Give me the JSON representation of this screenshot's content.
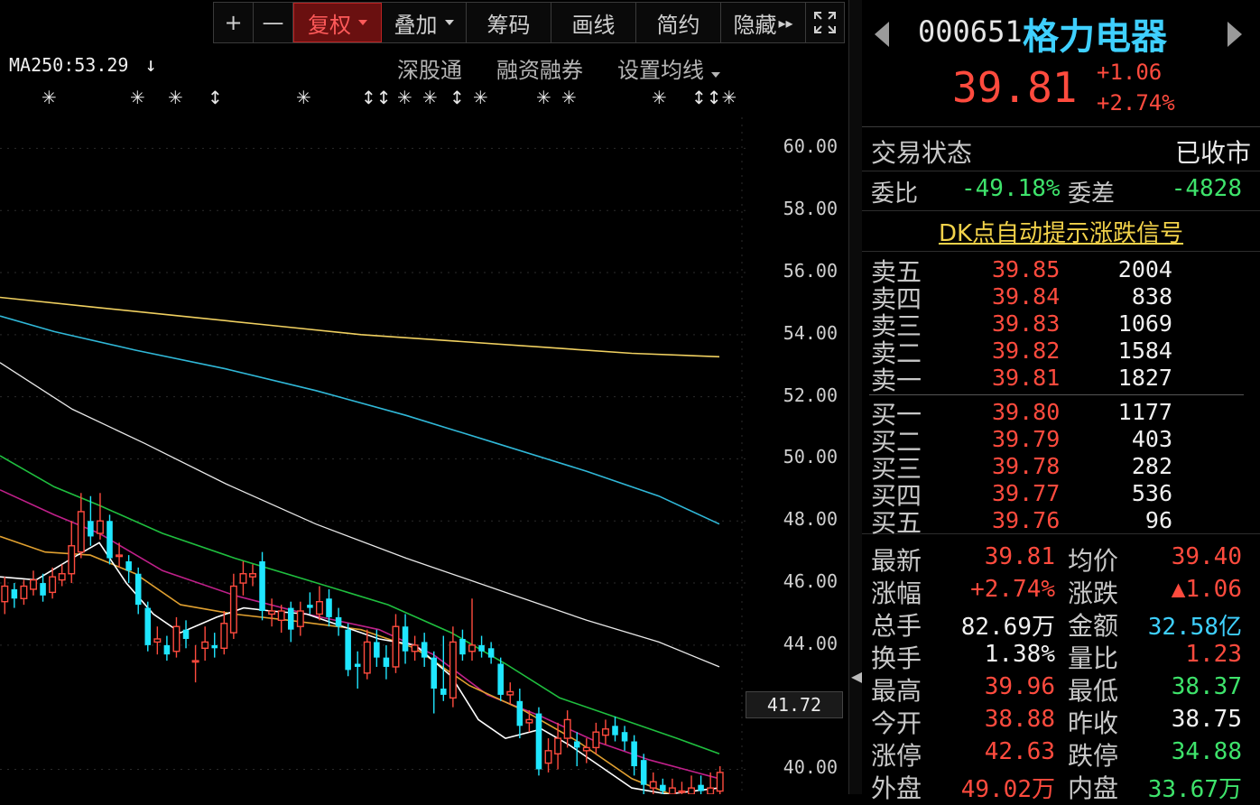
{
  "toolbar": {
    "plus": "+",
    "minus": "—",
    "fq": "复权",
    "overlay": "叠加",
    "chips": "筹码",
    "draw": "画线",
    "simple": "简约",
    "hide": "隐藏",
    "hide_more": "▸▸"
  },
  "ma_label": "MA250:53.29",
  "ma_arrow": "↓",
  "links": {
    "sz_connect": "深股通",
    "margin": "融资融券",
    "set_ma": "设置均线"
  },
  "markers": [
    "✳",
    "✳",
    "✳",
    "↕",
    "✳",
    "↕↕",
    "✳",
    "✳",
    "↕",
    "✳",
    "✳",
    "✳",
    "✳",
    "↕↕✳"
  ],
  "y_axis_labels": [
    "60.00",
    "58.00",
    "56.00",
    "54.00",
    "52.00",
    "50.00",
    "48.00",
    "46.00",
    "44.00",
    "40.00"
  ],
  "cursor_price": "41.72",
  "colors": {
    "up": "#ff4b3e",
    "down": "#1fe6ff",
    "ma5": "#ffffff",
    "ma10": "#e0a030",
    "ma20": "#c0208a",
    "ma30": "#1fbf3f",
    "ma60": "#e8e8e8",
    "ma120": "#30b8d8",
    "ma250": "#f0d060"
  },
  "chart_data": {
    "type": "candlestick",
    "ylim": [
      39.2,
      61.0
    ],
    "yticks": [
      60,
      58,
      56,
      54,
      52,
      50,
      48,
      46,
      44,
      40
    ],
    "candles": [
      {
        "o": 45.4,
        "c": 45.9,
        "h": 46.2,
        "l": 45.0
      },
      {
        "o": 45.8,
        "c": 45.5,
        "h": 46.0,
        "l": 45.2
      },
      {
        "o": 45.5,
        "c": 45.9,
        "h": 46.1,
        "l": 45.3
      },
      {
        "o": 45.8,
        "c": 46.1,
        "h": 46.4,
        "l": 45.6
      },
      {
        "o": 46.0,
        "c": 45.6,
        "h": 46.3,
        "l": 45.4
      },
      {
        "o": 45.7,
        "c": 46.2,
        "h": 46.5,
        "l": 45.5
      },
      {
        "o": 46.1,
        "c": 46.3,
        "h": 46.6,
        "l": 45.9
      },
      {
        "o": 46.3,
        "c": 47.2,
        "h": 48.0,
        "l": 46.0
      },
      {
        "o": 47.0,
        "c": 48.3,
        "h": 48.9,
        "l": 46.8
      },
      {
        "o": 48.0,
        "c": 47.5,
        "h": 48.8,
        "l": 47.2
      },
      {
        "o": 47.6,
        "c": 48.0,
        "h": 48.9,
        "l": 47.4
      },
      {
        "o": 48.0,
        "c": 46.8,
        "h": 48.2,
        "l": 46.6
      },
      {
        "o": 46.9,
        "c": 46.9,
        "h": 47.3,
        "l": 46.5
      },
      {
        "o": 46.7,
        "c": 46.4,
        "h": 46.9,
        "l": 46.0
      },
      {
        "o": 46.3,
        "c": 45.3,
        "h": 46.5,
        "l": 45.0
      },
      {
        "o": 45.2,
        "c": 44.0,
        "h": 45.4,
        "l": 43.8
      },
      {
        "o": 44.1,
        "c": 44.2,
        "h": 44.6,
        "l": 43.7
      },
      {
        "o": 44.0,
        "c": 43.7,
        "h": 44.3,
        "l": 43.5
      },
      {
        "o": 43.8,
        "c": 44.6,
        "h": 44.9,
        "l": 43.6
      },
      {
        "o": 44.5,
        "c": 44.2,
        "h": 44.8,
        "l": 43.9
      },
      {
        "o": 43.5,
        "c": 43.5,
        "h": 44.0,
        "l": 42.8
      },
      {
        "o": 43.9,
        "c": 44.1,
        "h": 44.6,
        "l": 43.5
      },
      {
        "o": 44.0,
        "c": 43.9,
        "h": 44.4,
        "l": 43.6
      },
      {
        "o": 43.9,
        "c": 44.7,
        "h": 45.1,
        "l": 43.7
      },
      {
        "o": 44.4,
        "c": 45.9,
        "h": 46.3,
        "l": 44.2
      },
      {
        "o": 46.0,
        "c": 46.3,
        "h": 46.7,
        "l": 45.6
      },
      {
        "o": 46.2,
        "c": 46.3,
        "h": 46.6,
        "l": 45.9
      },
      {
        "o": 46.7,
        "c": 45.1,
        "h": 47.0,
        "l": 44.8
      },
      {
        "o": 45.0,
        "c": 45.1,
        "h": 45.5,
        "l": 44.6
      },
      {
        "o": 44.8,
        "c": 45.1,
        "h": 45.3,
        "l": 44.4
      },
      {
        "o": 45.2,
        "c": 44.5,
        "h": 45.4,
        "l": 44.1
      },
      {
        "o": 44.6,
        "c": 45.1,
        "h": 45.4,
        "l": 44.3
      },
      {
        "o": 45.3,
        "c": 45.2,
        "h": 45.7,
        "l": 45.0
      },
      {
        "o": 45.0,
        "c": 45.4,
        "h": 45.9,
        "l": 44.8
      },
      {
        "o": 45.5,
        "c": 44.9,
        "h": 45.8,
        "l": 44.6
      },
      {
        "o": 44.9,
        "c": 44.6,
        "h": 45.2,
        "l": 44.3
      },
      {
        "o": 44.5,
        "c": 43.2,
        "h": 44.7,
        "l": 43.0
      },
      {
        "o": 43.4,
        "c": 43.3,
        "h": 43.8,
        "l": 42.6
      },
      {
        "o": 43.1,
        "c": 44.1,
        "h": 44.5,
        "l": 42.9
      },
      {
        "o": 44.1,
        "c": 43.6,
        "h": 44.5,
        "l": 43.3
      },
      {
        "o": 43.6,
        "c": 43.3,
        "h": 44.0,
        "l": 42.9
      },
      {
        "o": 43.3,
        "c": 44.6,
        "h": 45.0,
        "l": 43.1
      },
      {
        "o": 44.6,
        "c": 43.8,
        "h": 45.0,
        "l": 43.4
      },
      {
        "o": 43.8,
        "c": 44.0,
        "h": 44.3,
        "l": 43.5
      },
      {
        "o": 44.1,
        "c": 43.6,
        "h": 44.4,
        "l": 43.3
      },
      {
        "o": 43.6,
        "c": 42.6,
        "h": 43.8,
        "l": 41.8
      },
      {
        "o": 42.6,
        "c": 42.4,
        "h": 44.3,
        "l": 42.2
      },
      {
        "o": 42.3,
        "c": 44.1,
        "h": 44.6,
        "l": 42.0
      },
      {
        "o": 44.2,
        "c": 43.7,
        "h": 44.5,
        "l": 43.5
      },
      {
        "o": 43.8,
        "c": 44.0,
        "h": 45.5,
        "l": 43.5
      },
      {
        "o": 44.0,
        "c": 43.8,
        "h": 44.3,
        "l": 43.6
      },
      {
        "o": 43.9,
        "c": 43.6,
        "h": 44.1,
        "l": 43.4
      },
      {
        "o": 43.4,
        "c": 42.4,
        "h": 43.6,
        "l": 42.2
      },
      {
        "o": 42.4,
        "c": 42.5,
        "h": 42.8,
        "l": 42.1
      },
      {
        "o": 42.2,
        "c": 41.4,
        "h": 42.6,
        "l": 41.0
      },
      {
        "o": 41.5,
        "c": 41.6,
        "h": 41.9,
        "l": 41.2
      },
      {
        "o": 41.8,
        "c": 40.0,
        "h": 42.0,
        "l": 39.8
      },
      {
        "o": 40.2,
        "c": 40.6,
        "h": 41.0,
        "l": 39.9
      },
      {
        "o": 40.5,
        "c": 41.0,
        "h": 41.5,
        "l": 40.0
      },
      {
        "o": 41.0,
        "c": 41.6,
        "h": 41.9,
        "l": 40.7
      },
      {
        "o": 40.9,
        "c": 40.7,
        "h": 41.2,
        "l": 40.1
      },
      {
        "o": 40.6,
        "c": 40.7,
        "h": 41.0,
        "l": 40.2
      },
      {
        "o": 40.7,
        "c": 41.2,
        "h": 41.5,
        "l": 40.5
      },
      {
        "o": 41.1,
        "c": 41.3,
        "h": 41.6,
        "l": 40.8
      },
      {
        "o": 41.4,
        "c": 41.1,
        "h": 41.7,
        "l": 40.9
      },
      {
        "o": 41.2,
        "c": 40.9,
        "h": 41.4,
        "l": 40.6
      },
      {
        "o": 40.9,
        "c": 40.1,
        "h": 41.1,
        "l": 39.8
      },
      {
        "o": 40.3,
        "c": 39.5,
        "h": 40.5,
        "l": 39.2
      },
      {
        "o": 39.4,
        "c": 39.6,
        "h": 39.9,
        "l": 39.2
      },
      {
        "o": 39.5,
        "c": 39.3,
        "h": 39.7,
        "l": 39.1
      },
      {
        "o": 39.2,
        "c": 39.4,
        "h": 39.7,
        "l": 39.0
      },
      {
        "o": 39.3,
        "c": 39.3,
        "h": 39.6,
        "l": 39.1
      },
      {
        "o": 39.2,
        "c": 39.4,
        "h": 39.8,
        "l": 38.9
      },
      {
        "o": 39.5,
        "c": 39.3,
        "h": 39.8,
        "l": 39.0
      },
      {
        "o": 39.2,
        "c": 39.4,
        "h": 39.9,
        "l": 39.0
      },
      {
        "o": 39.3,
        "c": 39.9,
        "h": 40.1,
        "l": 38.9
      }
    ],
    "ma_lines": {
      "ma250": [
        [
          0,
          55.2
        ],
        [
          100,
          54.9
        ],
        [
          200,
          54.6
        ],
        [
          300,
          54.3
        ],
        [
          400,
          54.0
        ],
        [
          500,
          53.8
        ],
        [
          600,
          53.6
        ],
        [
          700,
          53.4
        ],
        [
          797,
          53.29
        ]
      ],
      "ma120": [
        [
          0,
          54.6
        ],
        [
          60,
          54.1
        ],
        [
          150,
          53.5
        ],
        [
          250,
          52.9
        ],
        [
          350,
          52.2
        ],
        [
          450,
          51.4
        ],
        [
          550,
          50.5
        ],
        [
          650,
          49.6
        ],
        [
          730,
          48.8
        ],
        [
          797,
          47.9
        ]
      ],
      "ma60": [
        [
          0,
          53.1
        ],
        [
          80,
          51.6
        ],
        [
          160,
          50.5
        ],
        [
          250,
          49.2
        ],
        [
          350,
          47.9
        ],
        [
          450,
          46.8
        ],
        [
          560,
          45.7
        ],
        [
          650,
          44.8
        ],
        [
          730,
          44.1
        ],
        [
          797,
          43.3
        ]
      ],
      "ma30": [
        [
          0,
          50.1
        ],
        [
          60,
          49.1
        ],
        [
          110,
          48.5
        ],
        [
          180,
          47.6
        ],
        [
          260,
          46.8
        ],
        [
          340,
          46.1
        ],
        [
          430,
          45.3
        ],
        [
          500,
          44.4
        ],
        [
          560,
          43.4
        ],
        [
          620,
          42.3
        ],
        [
          690,
          41.6
        ],
        [
          750,
          41.0
        ],
        [
          797,
          40.5
        ]
      ],
      "ma20": [
        [
          0,
          49.0
        ],
        [
          60,
          48.2
        ],
        [
          110,
          47.6
        ],
        [
          180,
          46.4
        ],
        [
          260,
          45.6
        ],
        [
          340,
          45.0
        ],
        [
          420,
          44.5
        ],
        [
          480,
          43.7
        ],
        [
          540,
          42.4
        ],
        [
          600,
          41.7
        ],
        [
          660,
          40.9
        ],
        [
          720,
          40.3
        ],
        [
          797,
          39.7
        ]
      ],
      "ma10": [
        [
          0,
          47.5
        ],
        [
          50,
          47.0
        ],
        [
          100,
          46.9
        ],
        [
          150,
          46.3
        ],
        [
          200,
          45.3
        ],
        [
          260,
          45.0
        ],
        [
          320,
          44.8
        ],
        [
          400,
          44.5
        ],
        [
          460,
          43.9
        ],
        [
          520,
          42.7
        ],
        [
          580,
          41.9
        ],
        [
          640,
          40.9
        ],
        [
          700,
          39.7
        ],
        [
          760,
          39.0
        ],
        [
          797,
          38.9
        ]
      ],
      "ma5": [
        [
          0,
          46.2
        ],
        [
          40,
          46.1
        ],
        [
          80,
          46.8
        ],
        [
          110,
          47.3
        ],
        [
          140,
          46.0
        ],
        [
          170,
          45.0
        ],
        [
          200,
          44.4
        ],
        [
          240,
          44.9
        ],
        [
          270,
          45.2
        ],
        [
          300,
          45.1
        ],
        [
          340,
          45.0
        ],
        [
          380,
          44.6
        ],
        [
          420,
          44.2
        ],
        [
          460,
          44.0
        ],
        [
          500,
          43.0
        ],
        [
          530,
          41.6
        ],
        [
          560,
          41.0
        ],
        [
          600,
          41.3
        ],
        [
          630,
          40.8
        ],
        [
          660,
          40.2
        ],
        [
          700,
          39.4
        ],
        [
          740,
          39.2
        ],
        [
          797,
          39.4
        ]
      ]
    }
  },
  "quote": {
    "code": "000651",
    "name": "格力电器",
    "price": "39.81",
    "chg_abs": "+1.06",
    "chg_pct": "+2.74%",
    "trade_status_label": "交易状态",
    "trade_status": "已收市",
    "wb_label": "委比",
    "wb_value": "-49.18%",
    "wc_label": "委差",
    "wc_value": "-4828",
    "dk_link": "DK点自动提示涨跌信号",
    "asks": [
      {
        "label": "卖五",
        "price": "39.85",
        "vol": "2004"
      },
      {
        "label": "卖四",
        "price": "39.84",
        "vol": "838"
      },
      {
        "label": "卖三",
        "price": "39.83",
        "vol": "1069"
      },
      {
        "label": "卖二",
        "price": "39.82",
        "vol": "1584"
      },
      {
        "label": "卖一",
        "price": "39.81",
        "vol": "1827"
      }
    ],
    "bids": [
      {
        "label": "买一",
        "price": "39.80",
        "vol": "1177"
      },
      {
        "label": "买二",
        "price": "39.79",
        "vol": "403"
      },
      {
        "label": "买三",
        "price": "39.78",
        "vol": "282"
      },
      {
        "label": "买四",
        "price": "39.77",
        "vol": "536"
      },
      {
        "label": "买五",
        "price": "39.76",
        "vol": "96"
      }
    ],
    "stats": [
      {
        "k1": "最新",
        "v1": "39.81",
        "c1": "red",
        "k2": "均价",
        "v2": "39.40",
        "c2": "red"
      },
      {
        "k1": "涨幅",
        "v1": "+2.74%",
        "c1": "red",
        "k2": "涨跌",
        "v2": "▲1.06",
        "c2": "red"
      },
      {
        "k1": "总手",
        "v1": "82.69万",
        "c1": "white",
        "k2": "金额",
        "v2": "32.58亿",
        "c2": "cyan"
      },
      {
        "k1": "换手",
        "v1": "1.38%",
        "c1": "white",
        "k2": "量比",
        "v2": "1.23",
        "c2": "red"
      },
      {
        "k1": "最高",
        "v1": "39.96",
        "c1": "red",
        "k2": "最低",
        "v2": "38.37",
        "c2": "green"
      },
      {
        "k1": "今开",
        "v1": "38.88",
        "c1": "red",
        "k2": "昨收",
        "v2": "38.75",
        "c2": "white"
      },
      {
        "k1": "涨停",
        "v1": "42.63",
        "c1": "red",
        "k2": "跌停",
        "v2": "34.88",
        "c2": "green"
      },
      {
        "k1": "外盘",
        "v1": "49.02万",
        "c1": "red",
        "k2": "内盘",
        "v2": "33.67万",
        "c2": "green"
      }
    ]
  }
}
